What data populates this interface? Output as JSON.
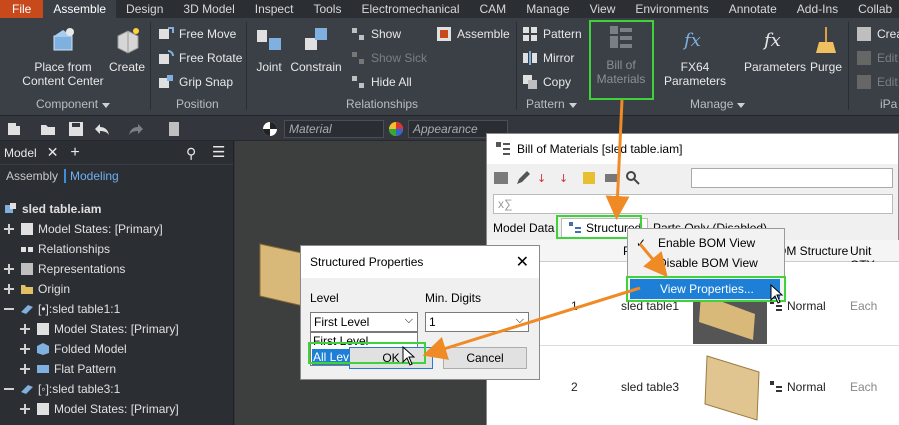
{
  "menu": {
    "items": [
      "File",
      "Assemble",
      "Design",
      "3D Model",
      "Inspect",
      "Tools",
      "Electromechanical",
      "CAM",
      "Manage",
      "View",
      "Environments",
      "Annotate",
      "Add-Ins",
      "Collab"
    ],
    "active": "Assemble"
  },
  "ribbon": {
    "component": {
      "place_line1": "Place from",
      "place_line2": "Content Center",
      "create": "Create",
      "label": "Component"
    },
    "position": {
      "free_move": "Free Move",
      "free_rotate": "Free Rotate",
      "grip_snap": "Grip Snap",
      "label": "Position"
    },
    "relationships": {
      "joint": "Joint",
      "constrain": "Constrain",
      "show": "Show",
      "show_sick": "Show Sick",
      "hide_all": "Hide All",
      "assemble": "Assemble",
      "label": "Relationships"
    },
    "pattern": {
      "pattern": "Pattern",
      "mirror": "Mirror",
      "copy": "Copy",
      "label": "Pattern"
    },
    "manage": {
      "bom_line1": "Bill of",
      "bom_line2": "Materials",
      "fx64": "FX64 Parameters",
      "parameters": "Parameters",
      "purge": "Purge",
      "label": "Manage"
    },
    "ipart": {
      "create": "Crea",
      "edit1": "Edit",
      "edit2": "Edit",
      "label": "iPa"
    }
  },
  "quicktools": {
    "material": "Material",
    "appearance": "Appearance"
  },
  "browser": {
    "tab": "Model",
    "sub_assembly": "Assembly",
    "sub_modeling": "Modeling",
    "root": "sled table.iam",
    "rows": [
      "Model States: [Primary]",
      "Relationships",
      "Representations",
      "Origin",
      "[•]:sled table1:1",
      "Model States: [Primary]",
      "Folded Model",
      "Flat Pattern",
      "[◦]:sled table3:1",
      "Model States: [Primary]"
    ]
  },
  "bom": {
    "title": "Bill of Materials [sled table.iam]",
    "tab_model_data": "Model Data",
    "tab_structured": "Structured",
    "tab_parts_only": "Parts Only (Disabled)",
    "col_bom_structure": "OM Structure",
    "col_unit_qty": "Unit QTY",
    "col_p": "P",
    "rows": [
      {
        "item": "1",
        "part": "sled table1",
        "structure": "Normal",
        "qty": "Each"
      },
      {
        "item": "2",
        "part": "sled table3",
        "structure": "Normal",
        "qty": "Each"
      }
    ]
  },
  "context_menu": {
    "enable": "Enable BOM View",
    "disable": "Disable BOM View",
    "view_props": "View Properties..."
  },
  "structured_props": {
    "title": "Structured Properties",
    "level_label": "Level",
    "digits_label": "Min. Digits",
    "level_value": "First Level",
    "digits_value": "1",
    "options": [
      "First Level",
      "All Levels"
    ],
    "ok": "OK",
    "cancel": "Cancel"
  },
  "colors": {
    "highlight": "#3fd23a",
    "arrow": "#f08a24",
    "file_tab": "#c8491c",
    "accent": "#3f8fd8"
  }
}
